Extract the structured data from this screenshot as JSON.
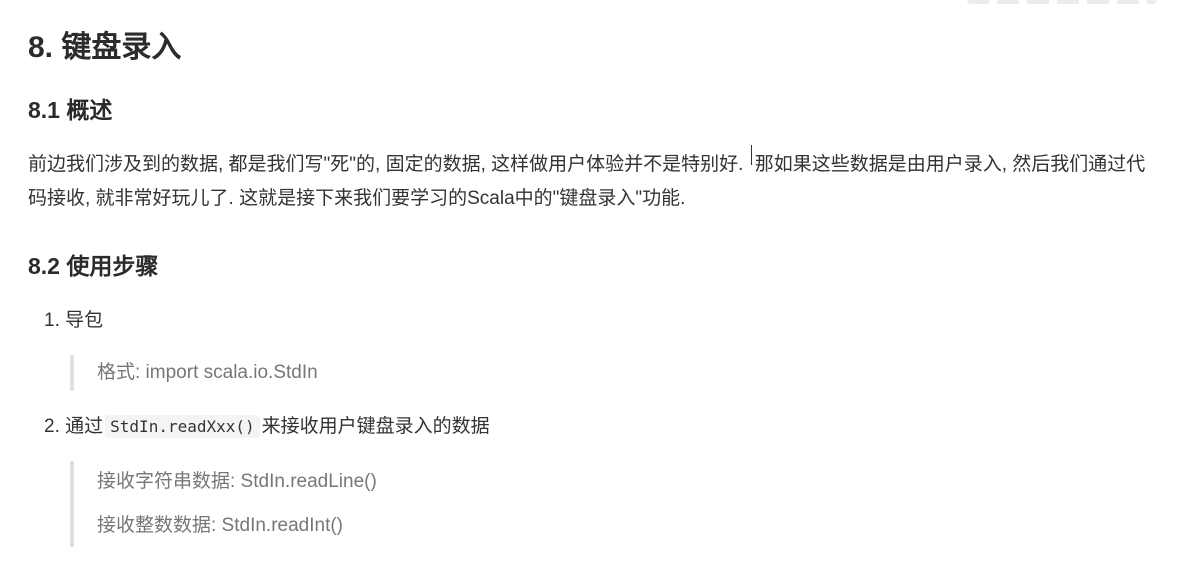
{
  "heading": "8. 键盘录入",
  "overview": {
    "title": "8.1 概述",
    "paragraph_before_cursor": "前边我们涉及到的数据, 都是我们写\"死\"的, 固定的数据, 这样做用户体验并不是特别好. ",
    "paragraph_after_cursor": "那如果这些数据是由用户录入, 然后我们通过代码接收, 就非常好玩儿了. 这就是接下来我们要学习的Scala中的\"键盘录入\"功能."
  },
  "steps": {
    "title": "8.2 使用步骤",
    "items": [
      {
        "number": "1.",
        "text": "导包",
        "quote": [
          "格式: import scala.io.StdIn"
        ]
      },
      {
        "number": "2.",
        "text_before": "通过",
        "code": "StdIn.readXxx()",
        "text_after": "来接收用户键盘录入的数据",
        "quote": [
          "接收字符串数据:  StdIn.readLine()",
          "接收整数数据:  StdIn.readInt()"
        ]
      }
    ]
  }
}
